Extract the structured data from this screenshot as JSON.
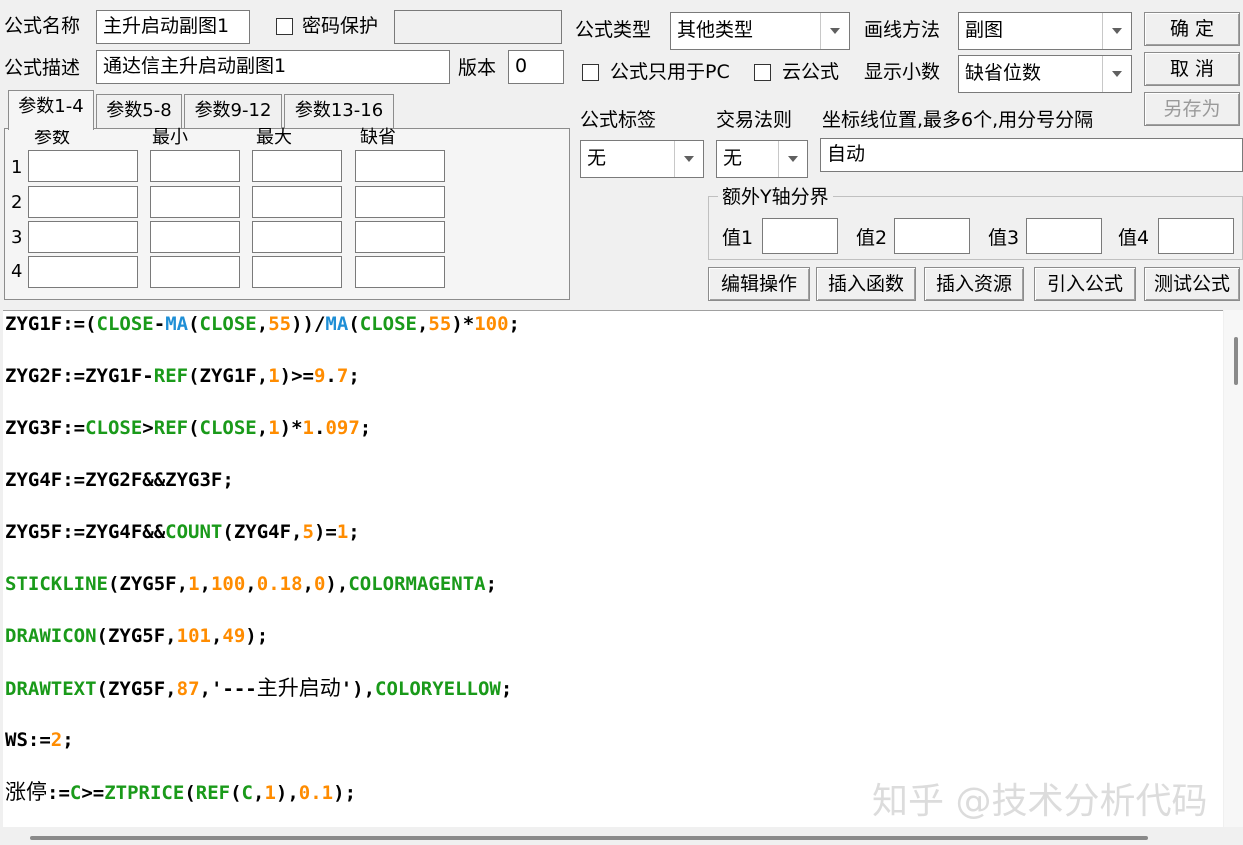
{
  "header": {
    "formula_name_label": "公式名称",
    "formula_name_value": "主升启动副图1",
    "password_label": "密码保护",
    "password_value": "",
    "formula_desc_label": "公式描述",
    "formula_desc_value": "通达信主升启动副图1",
    "version_label": "版本",
    "version_value": "0",
    "formula_type_label": "公式类型",
    "formula_type_value": "其他类型",
    "draw_method_label": "画线方法",
    "draw_method_value": "副图",
    "pc_only_label": "公式只用于PC",
    "cloud_label": "云公式",
    "decimals_label": "显示小数",
    "decimals_value": "缺省位数"
  },
  "buttons": {
    "ok": "确  定",
    "cancel": "取  消",
    "save_as": "另存为",
    "edit_ops": "编辑操作",
    "insert_func": "插入函数",
    "insert_resource": "插入资源",
    "import_formula": "引入公式",
    "test_formula": "测试公式"
  },
  "tabs": [
    "参数1-4",
    "参数5-8",
    "参数9-12",
    "参数13-16"
  ],
  "params_table": {
    "headers": [
      "参数",
      "最小",
      "最大",
      "缺省"
    ],
    "rows": [
      "1",
      "2",
      "3",
      "4"
    ]
  },
  "tags": {
    "formula_tag_label": "公式标签",
    "formula_tag_value": "无",
    "trade_rule_label": "交易法则",
    "trade_rule_value": "无",
    "axis_label": "坐标线位置,最多6个,用分号分隔",
    "axis_value": "自动"
  },
  "y_axis": {
    "group_label": "额外Y轴分界",
    "v1_label": "值1",
    "v2_label": "值2",
    "v3_label": "值3",
    "v4_label": "值4"
  },
  "colors": {
    "keyword": "#1a9a1a",
    "function_blue": "#1f8fd6",
    "number": "#ff8c00",
    "plain": "#000000"
  },
  "code_lines": [
    [
      [
        "t",
        "ZYG1F"
      ],
      [
        "o",
        ":="
      ],
      [
        "o",
        "("
      ],
      [
        "k",
        "CLOSE"
      ],
      [
        "o",
        "-"
      ],
      [
        "b",
        "MA"
      ],
      [
        "o",
        "("
      ],
      [
        "k",
        "CLOSE"
      ],
      [
        "o",
        ","
      ],
      [
        "n",
        "55"
      ],
      [
        "o",
        "))/"
      ],
      [
        "b",
        "MA"
      ],
      [
        "o",
        "("
      ],
      [
        "k",
        "CLOSE"
      ],
      [
        "o",
        ","
      ],
      [
        "n",
        "55"
      ],
      [
        "o",
        ")*"
      ],
      [
        "n",
        "100"
      ],
      [
        "o",
        ";"
      ]
    ],
    [
      [
        "t",
        "ZYG2F"
      ],
      [
        "o",
        ":="
      ],
      [
        "t",
        "ZYG1F"
      ],
      [
        "o",
        "-"
      ],
      [
        "k",
        "REF"
      ],
      [
        "o",
        "("
      ],
      [
        "t",
        "ZYG1F"
      ],
      [
        "o",
        ","
      ],
      [
        "n",
        "1"
      ],
      [
        "o",
        ")>="
      ],
      [
        "n",
        "9"
      ],
      [
        "o",
        "."
      ],
      [
        "n",
        "7"
      ],
      [
        "o",
        ";"
      ]
    ],
    [
      [
        "t",
        "ZYG3F"
      ],
      [
        "o",
        ":="
      ],
      [
        "k",
        "CLOSE"
      ],
      [
        "o",
        ">"
      ],
      [
        "k",
        "REF"
      ],
      [
        "o",
        "("
      ],
      [
        "k",
        "CLOSE"
      ],
      [
        "o",
        ","
      ],
      [
        "n",
        "1"
      ],
      [
        "o",
        ")*"
      ],
      [
        "n",
        "1"
      ],
      [
        "o",
        "."
      ],
      [
        "n",
        "097"
      ],
      [
        "o",
        ";"
      ]
    ],
    [
      [
        "t",
        "ZYG4F"
      ],
      [
        "o",
        ":="
      ],
      [
        "t",
        "ZYG2F&&ZYG3F"
      ],
      [
        "o",
        ";"
      ]
    ],
    [
      [
        "t",
        "ZYG5F"
      ],
      [
        "o",
        ":="
      ],
      [
        "t",
        "ZYG4F&&"
      ],
      [
        "k",
        "COUNT"
      ],
      [
        "o",
        "("
      ],
      [
        "t",
        "ZYG4F"
      ],
      [
        "o",
        ","
      ],
      [
        "n",
        "5"
      ],
      [
        "o",
        ")="
      ],
      [
        "n",
        "1"
      ],
      [
        "o",
        ";"
      ]
    ],
    [
      [
        "k",
        "STICKLINE"
      ],
      [
        "o",
        "("
      ],
      [
        "t",
        "ZYG5F"
      ],
      [
        "o",
        ","
      ],
      [
        "n",
        "1"
      ],
      [
        "o",
        ","
      ],
      [
        "n",
        "100"
      ],
      [
        "o",
        ","
      ],
      [
        "n",
        "0.18"
      ],
      [
        "o",
        ","
      ],
      [
        "n",
        "0"
      ],
      [
        "o",
        "),"
      ],
      [
        "k",
        "COLORMAGENTA"
      ],
      [
        "o",
        ";"
      ]
    ],
    [
      [
        "k",
        "DRAWICON"
      ],
      [
        "o",
        "("
      ],
      [
        "t",
        "ZYG5F"
      ],
      [
        "o",
        ","
      ],
      [
        "n",
        "101"
      ],
      [
        "o",
        ","
      ],
      [
        "n",
        "49"
      ],
      [
        "o",
        ");"
      ]
    ],
    [
      [
        "k",
        "DRAWTEXT"
      ],
      [
        "o",
        "("
      ],
      [
        "t",
        "ZYG5F"
      ],
      [
        "o",
        ","
      ],
      [
        "n",
        "87"
      ],
      [
        "o",
        ",'---"
      ],
      [
        "s",
        "主升启动"
      ],
      [
        "o",
        "'),"
      ],
      [
        "k",
        "COLORYELLOW"
      ],
      [
        "o",
        ";"
      ]
    ],
    [
      [
        "t",
        "WS"
      ],
      [
        "o",
        ":="
      ],
      [
        "n",
        "2"
      ],
      [
        "o",
        ";"
      ]
    ],
    [
      [
        "s",
        "涨停"
      ],
      [
        "o",
        ":="
      ],
      [
        "k",
        "C"
      ],
      [
        "o",
        ">="
      ],
      [
        "k",
        "ZTPRICE"
      ],
      [
        "o",
        "("
      ],
      [
        "k",
        "REF"
      ],
      [
        "o",
        "("
      ],
      [
        "k",
        "C"
      ],
      [
        "o",
        ","
      ],
      [
        "n",
        "1"
      ],
      [
        "o",
        "),"
      ],
      [
        "n",
        "0.1"
      ],
      [
        "o",
        ");"
      ]
    ]
  ],
  "watermark": "知乎 @技术分析代码"
}
